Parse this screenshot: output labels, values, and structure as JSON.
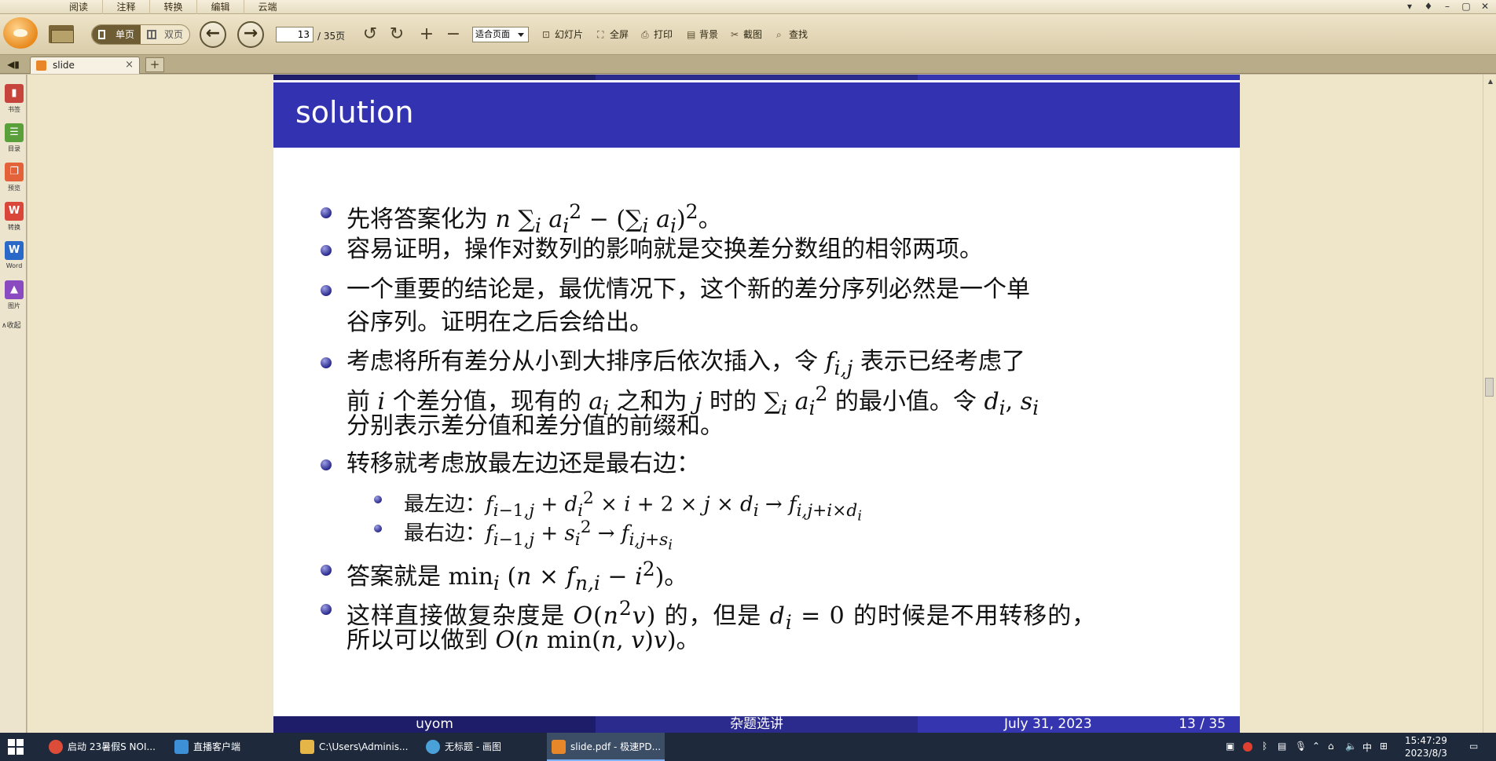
{
  "menu": {
    "tabs": [
      "阅读",
      "注释",
      "转换",
      "编辑",
      "云端"
    ]
  },
  "window_controls": [
    "▾",
    "♦",
    "–",
    "▢",
    "✕"
  ],
  "toolbar": {
    "single_page": "单页",
    "double_page": "双页",
    "page_current": "13",
    "page_total": "/ 35页",
    "zoom": "适合页面",
    "slideshow": "幻灯片",
    "fullscreen": "全屏",
    "print": "打印",
    "background": "背景",
    "screenshot": "截图",
    "find": "查找"
  },
  "tab": {
    "name": "slide",
    "close": "×",
    "new": "+"
  },
  "sidebar": {
    "items": [
      {
        "label": "书签",
        "color": "#c6443c",
        "glyph": "▮"
      },
      {
        "label": "目录",
        "color": "#5aa03a",
        "glyph": "☰"
      },
      {
        "label": "预览",
        "color": "#e3623a",
        "glyph": "❐"
      },
      {
        "label": "转换",
        "color": "#d8473a",
        "glyph": "W"
      },
      {
        "label": "Word",
        "color": "#2b69c8",
        "glyph": "W"
      },
      {
        "label": "图片",
        "color": "#8a4ac0",
        "glyph": "▲"
      }
    ],
    "collapse": "∧收起"
  },
  "slide": {
    "title": "solution",
    "footer": {
      "author": "uyom",
      "section": "杂题选讲",
      "date": "July 31, 2023",
      "page": "13 / 35"
    }
  },
  "taskbar": {
    "items": [
      {
        "label": "启动 23暑假S NOI...",
        "color": "#dd4b39"
      },
      {
        "label": "直播客户端",
        "color": "#3d8fd6"
      },
      {
        "label": "C:\\Users\\Adminis...",
        "color": "#e6b548"
      },
      {
        "label": "无标题 - 画图",
        "color": "#4aa0d8"
      },
      {
        "label": "slide.pdf - 极速PD...",
        "color": "#e8872a"
      }
    ],
    "ime": "中",
    "time": "15:47:29",
    "date": "2023/8/3"
  }
}
